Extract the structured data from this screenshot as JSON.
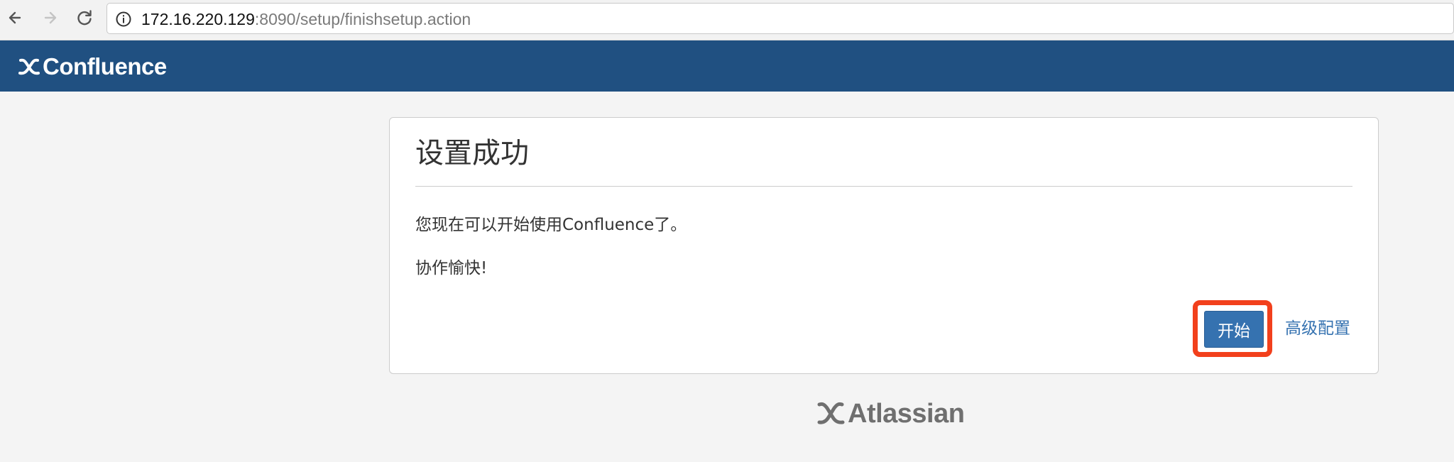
{
  "browser": {
    "url_host": "172.16.220.129",
    "url_rest": ":8090/setup/finishsetup.action",
    "icons": {
      "back": "back-arrow-icon",
      "forward": "forward-arrow-icon",
      "reload": "reload-icon",
      "info": "info-icon"
    }
  },
  "header": {
    "logo_text": "Confluence",
    "background": "#205081"
  },
  "card": {
    "title": "设置成功",
    "message": "您现在可以开始使用Confluence了。",
    "subtext": "协作愉快!",
    "start_button": "开始",
    "advanced_link": "高级配置",
    "accent": "#3572b0",
    "highlight_color": "#f2401c"
  },
  "footer": {
    "logo_text": "Atlassian"
  }
}
